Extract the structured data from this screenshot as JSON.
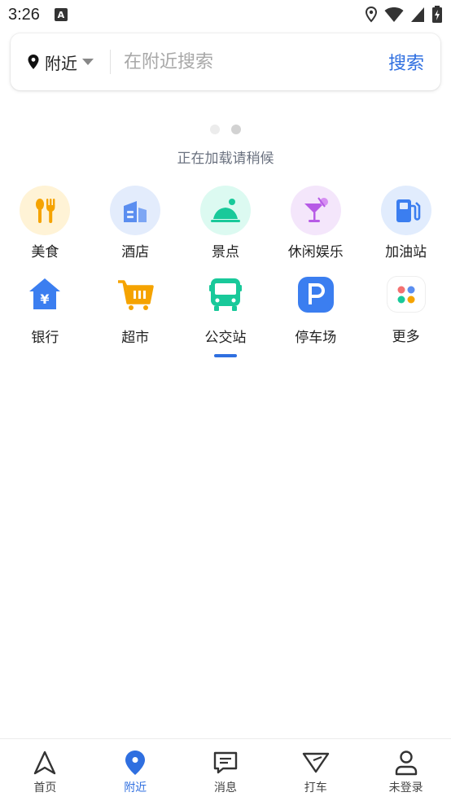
{
  "status_bar": {
    "time": "3:26",
    "notification_icon": "a-icon",
    "icons": [
      "location-icon",
      "wifi-icon",
      "signal-icon",
      "battery-charging-icon"
    ]
  },
  "search": {
    "location_label": "附近",
    "placeholder": "在附近搜索",
    "button_label": "搜索"
  },
  "loading": {
    "text": "正在加载请稍候"
  },
  "categories": [
    {
      "label": "美食",
      "icon": "food-icon"
    },
    {
      "label": "酒店",
      "icon": "hotel-icon"
    },
    {
      "label": "景点",
      "icon": "scenic-icon"
    },
    {
      "label": "休闲娱乐",
      "icon": "cocktail-icon"
    },
    {
      "label": "加油站",
      "icon": "gas-station-icon"
    },
    {
      "label": "银行",
      "icon": "bank-icon"
    },
    {
      "label": "超市",
      "icon": "cart-icon"
    },
    {
      "label": "公交站",
      "icon": "bus-icon"
    },
    {
      "label": "停车场",
      "icon": "parking-icon"
    },
    {
      "label": "更多",
      "icon": "more-icon"
    }
  ],
  "bottom_nav": [
    {
      "label": "首页",
      "icon": "navigate-icon",
      "active": false
    },
    {
      "label": "附近",
      "icon": "location-pin-icon",
      "active": true
    },
    {
      "label": "消息",
      "icon": "message-icon",
      "active": false
    },
    {
      "label": "打车",
      "icon": "taxi-icon",
      "active": false
    },
    {
      "label": "未登录",
      "icon": "user-icon",
      "active": false
    }
  ],
  "colors": {
    "accent": "#2f6fe0",
    "food_bg": "#fff3d6",
    "food_fg": "#f5a300",
    "hotel_bg": "#e3ecfc",
    "hotel_fg": "#5b8ef0",
    "scenic_bg": "#dcfaf1",
    "scenic_fg": "#19c99a",
    "leisure_bg": "#f4e6fb",
    "leisure_fg": "#b75be6",
    "gas_bg": "#e1ecfd",
    "gas_fg": "#3b7ef0"
  }
}
